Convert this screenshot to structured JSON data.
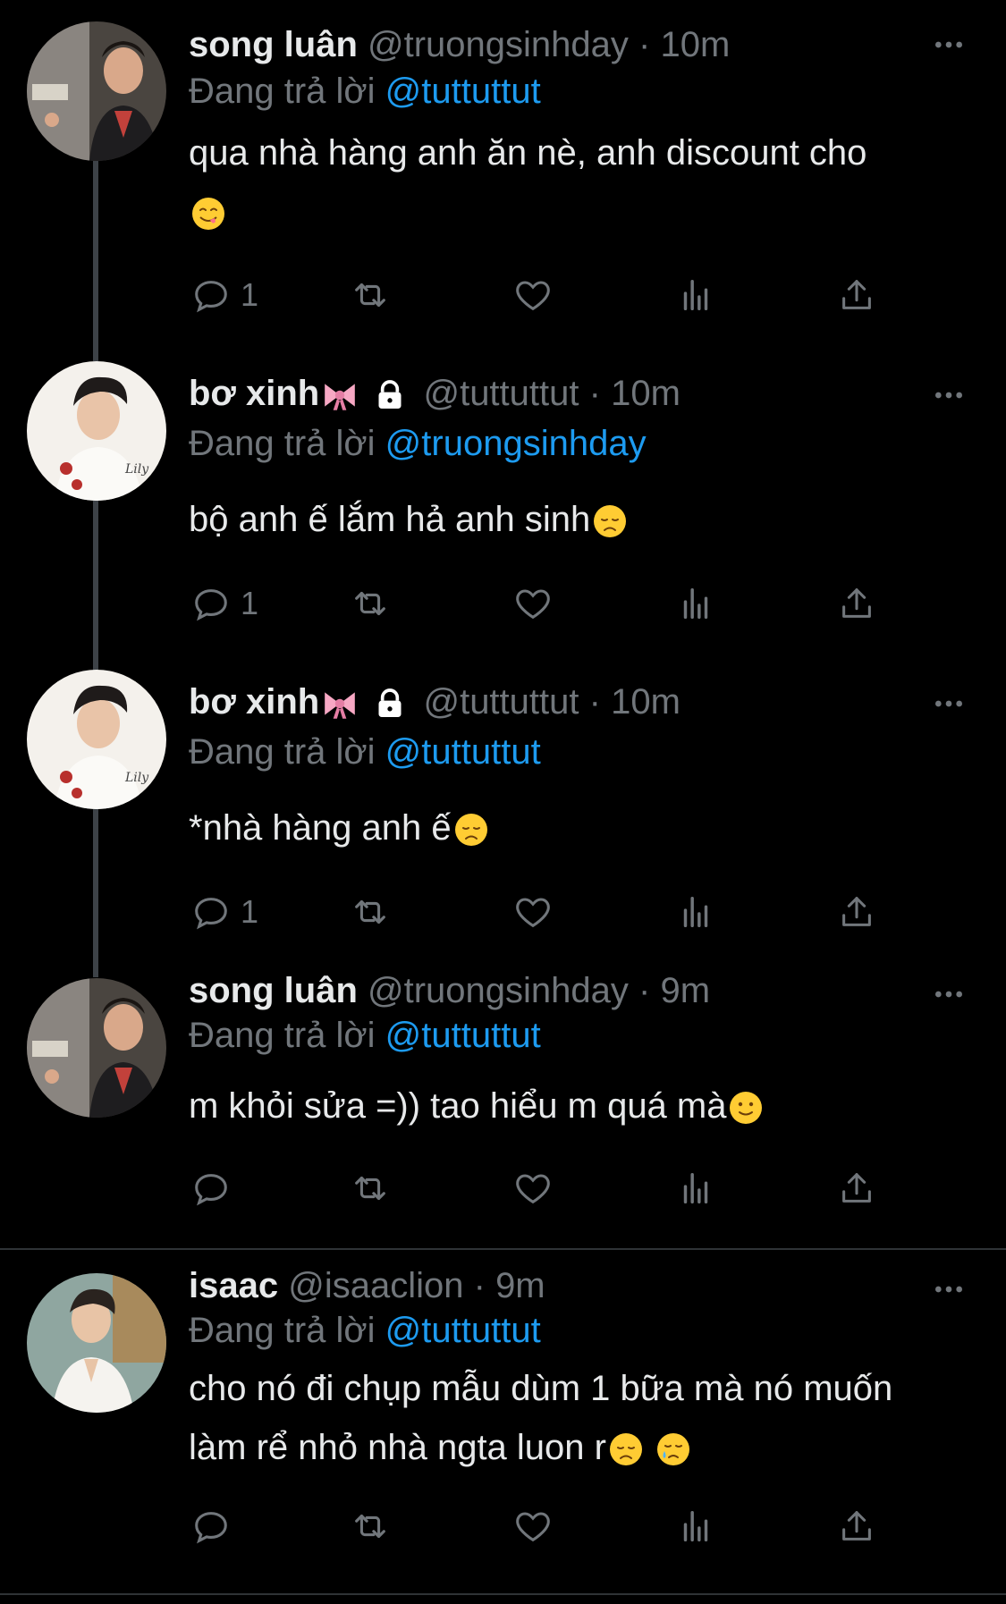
{
  "colors": {
    "background": "#000000",
    "text": "#e7e9ea",
    "muted": "#71767b",
    "mention": "#1d9bf0",
    "thread_line": "#3d4247"
  },
  "tweets": [
    {
      "name": "song luân",
      "handle": "@truongsinhday",
      "time": "10m",
      "reply_prefix": "Đang trả lời",
      "reply_to": "@tuttuttut",
      "text_lines": [
        "qua nhà hàng anh ăn nè, anh discount cho",
        ""
      ],
      "emojis": [
        "yum-face-emoji"
      ],
      "reply_count": "1",
      "locked": false,
      "avatar": "avatar-song-luan"
    },
    {
      "name": "bơ xinh",
      "handle": "@tuttuttut",
      "time": "10m",
      "reply_prefix": "Đang trả lời",
      "reply_to": "@truongsinhday",
      "text_lines": [
        "bộ anh ế lắm hả anh sinh"
      ],
      "emojis": [
        "disappointed-face-emoji"
      ],
      "reply_count": "1",
      "locked": true,
      "avatar": "avatar-bo-xinh"
    },
    {
      "name": "bơ xinh",
      "handle": "@tuttuttut",
      "time": "10m",
      "reply_prefix": "Đang trả lời",
      "reply_to": "@tuttuttut",
      "text_lines": [
        "*nhà hàng anh ế"
      ],
      "emojis": [
        "disappointed-face-emoji"
      ],
      "reply_count": "1",
      "locked": true,
      "avatar": "avatar-bo-xinh"
    },
    {
      "name": "song luân",
      "handle": "@truongsinhday",
      "time": "9m",
      "reply_prefix": "Đang trả lời",
      "reply_to": "@tuttuttut",
      "text_lines": [
        "m khỏi sửa =)) tao hiểu m quá mà"
      ],
      "emojis": [
        "slight-smile-emoji"
      ],
      "reply_count": "",
      "locked": false,
      "avatar": "avatar-song-luan"
    },
    {
      "name": "isaac",
      "handle": "@isaaclion",
      "time": "9m",
      "reply_prefix": "Đang trả lời",
      "reply_to": "@tuttuttut",
      "text_lines": [
        "cho nó đi chụp mẫu dùm 1 bữa mà nó muốn",
        "làm rể nhỏ nhà ngta luon r"
      ],
      "emojis": [
        "disappointed-face-emoji",
        "crying-face-emoji"
      ],
      "reply_count": "",
      "locked": false,
      "avatar": "avatar-isaac"
    }
  ],
  "icons": {
    "reply": "reply-icon",
    "retweet": "retweet-icon",
    "like": "heart-icon",
    "views": "analytics-icon",
    "share": "share-icon",
    "more": "more-icon",
    "lock": "lock-icon",
    "bow": "ribbon-emoji"
  }
}
